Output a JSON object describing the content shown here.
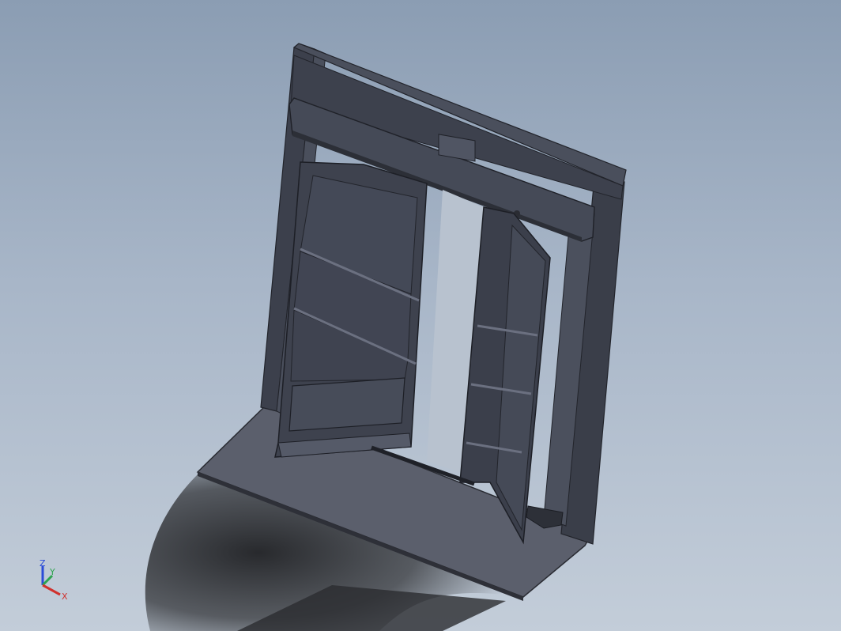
{
  "viewport": {
    "background_top": "#8b9db3",
    "background_bottom": "#c3cdd9",
    "model_color": "#3f4350",
    "shadow_color": "#2f3033"
  },
  "triad": {
    "x_label": "X",
    "y_label": "Y",
    "z_label": "Z",
    "x_color": "#d0312d",
    "y_color": "#2ea44f",
    "z_color": "#2b4bd8"
  }
}
